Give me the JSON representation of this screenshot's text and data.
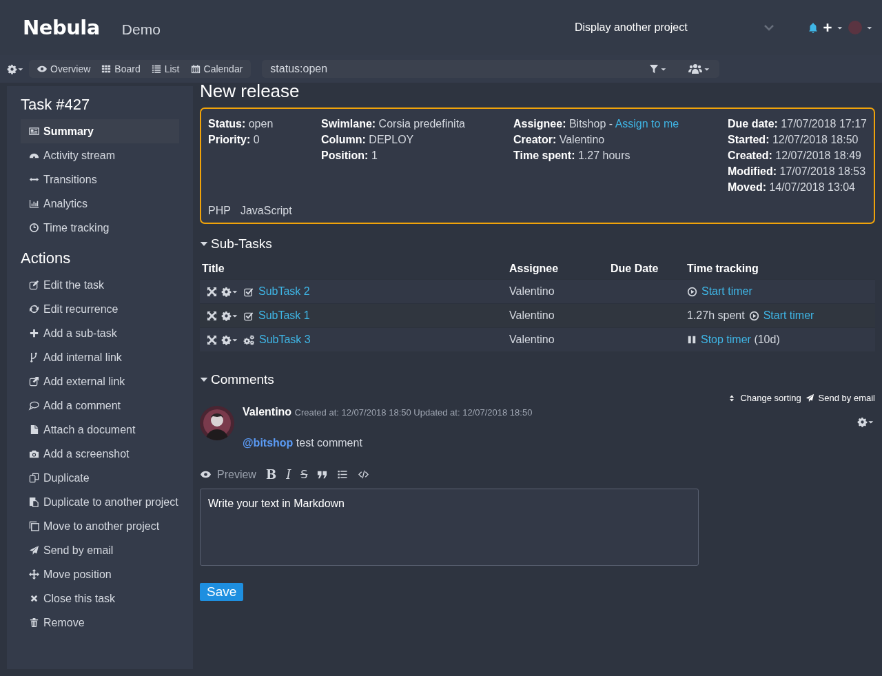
{
  "header": {
    "logo": "Nebula",
    "project": "Demo",
    "project_select": {
      "placeholder": "Display another project"
    }
  },
  "view_tabs": [
    {
      "label": "Overview",
      "selected": false
    },
    {
      "label": "Board",
      "selected": false
    },
    {
      "label": "List",
      "selected": false
    },
    {
      "label": "Calendar",
      "selected": false
    }
  ],
  "filter": {
    "value": "status:open"
  },
  "sidebar": {
    "title": "Task #427",
    "items": [
      {
        "label": "Summary",
        "selected": true
      },
      {
        "label": "Activity stream",
        "selected": false
      },
      {
        "label": "Transitions",
        "selected": false
      },
      {
        "label": "Analytics",
        "selected": false
      },
      {
        "label": "Time tracking",
        "selected": false
      }
    ],
    "actions_title": "Actions",
    "actions": [
      "Edit the task",
      "Edit recurrence",
      "Add a sub-task",
      "Add internal link",
      "Add external link",
      "Add a comment",
      "Attach a document",
      "Add a screenshot",
      "Duplicate",
      "Duplicate to another project",
      "Move to another project",
      "Send by email",
      "Move position",
      "Close this task",
      "Remove"
    ]
  },
  "task": {
    "title": "New release",
    "columns": [
      [
        {
          "label": "Status:",
          "value": "open"
        },
        {
          "label": "Priority:",
          "value": "0"
        }
      ],
      [
        {
          "label": "Swimlane:",
          "value": "Corsia predefinita"
        },
        {
          "label": "Column:",
          "value": "DEPLOY"
        },
        {
          "label": "Position:",
          "value": "1"
        }
      ],
      [
        {
          "label": "Assignee:",
          "value": "Bitshop - ",
          "link": "Assign to me"
        },
        {
          "label": "Creator:",
          "value": "Valentino"
        },
        {
          "label": "Time spent:",
          "value": "1.27 hours"
        }
      ],
      [
        {
          "label": "Due date:",
          "value": "17/07/2018 17:17"
        },
        {
          "label": "Started:",
          "value": "12/07/2018 18:50"
        },
        {
          "label": "Created:",
          "value": "12/07/2018 18:49"
        },
        {
          "label": "Modified:",
          "value": "17/07/2018 18:53"
        },
        {
          "label": "Moved:",
          "value": "14/07/2018 13:04"
        }
      ]
    ],
    "tags": [
      "PHP",
      "JavaScript"
    ]
  },
  "subtasks": {
    "heading": "Sub-Tasks",
    "expanded": true,
    "columns": [
      "Title",
      "Assignee",
      "Due Date",
      "Time tracking"
    ],
    "rows": [
      {
        "title": "SubTask 2",
        "kind": "done",
        "assignee": "Valentino",
        "spent": "",
        "timer": "Start timer",
        "timer_running": false,
        "note": ""
      },
      {
        "title": "SubTask 1",
        "kind": "done",
        "assignee": "Valentino",
        "spent": "1.27h spent",
        "timer": "Start timer",
        "timer_running": false,
        "note": ""
      },
      {
        "title": "SubTask 3",
        "kind": "in_progress",
        "assignee": "Valentino",
        "spent": "",
        "timer": "Stop timer",
        "timer_running": true,
        "note": "(10d)"
      }
    ]
  },
  "comments": {
    "heading": "Comments",
    "expanded": true,
    "change_sorting": "Change sorting",
    "send_by_email": "Send by email",
    "items": [
      {
        "author": "Valentino",
        "meta": "Created at: 12/07/2018 18:50 Updated at: 12/07/2018 18:50",
        "mention": "@bitshop",
        "text": "test comment"
      }
    ],
    "editor": {
      "preview": "Preview",
      "bold": "B",
      "italic": "I",
      "strike": "S",
      "placeholder": "Write your text in Markdown"
    },
    "save": "Save"
  }
}
